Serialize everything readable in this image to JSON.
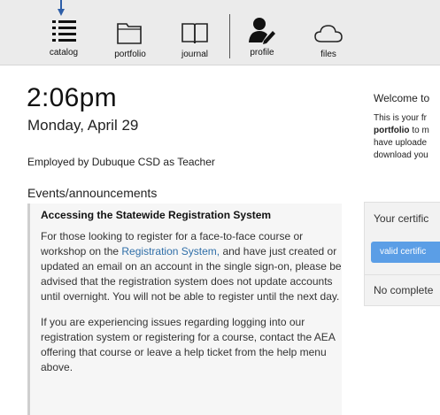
{
  "toolbar": {
    "items": [
      {
        "label": "catalog",
        "icon": "catalog-list-icon"
      },
      {
        "label": "portfolio",
        "icon": "folder-icon"
      },
      {
        "label": "journal",
        "icon": "book-icon"
      },
      {
        "label": "profile",
        "icon": "user-edit-icon"
      },
      {
        "label": "files",
        "icon": "cloud-icon"
      }
    ]
  },
  "dashboard": {
    "time": "2:06pm",
    "date": "Monday, April 29",
    "employment": "Employed by Dubuque CSD as Teacher",
    "events_heading": "Events/announcements"
  },
  "announcement": {
    "title": "Accessing the Statewide Registration System",
    "p1_before": "For those looking to register for a face-to-face course or workshop on the ",
    "p1_link": "Registration System,",
    "p1_after": " and have just created or updated an email on an account in the single sign-on, please be advised that the registration system does not update accounts until overnight. You will not be able to register until the next day.",
    "p2": "If you are experiencing issues regarding logging into our registration system or registering for a course, contact the AEA offering that course or leave a help ticket from the help menu above."
  },
  "right_panel": {
    "welcome": "Welcome to",
    "intro_1": "This is your fr",
    "intro_2_bold": "portfolio",
    "intro_2": " to m",
    "intro_3": "have uploade",
    "intro_4": "download you",
    "certificates_heading": "Your certific",
    "valid_button": "valid certific",
    "no_completions": "No complete"
  },
  "colors": {
    "toolbar_bg": "#ebebeb",
    "link": "#2f6ea8",
    "button": "#5b9ee6",
    "pointer": "#2d5ea8"
  }
}
